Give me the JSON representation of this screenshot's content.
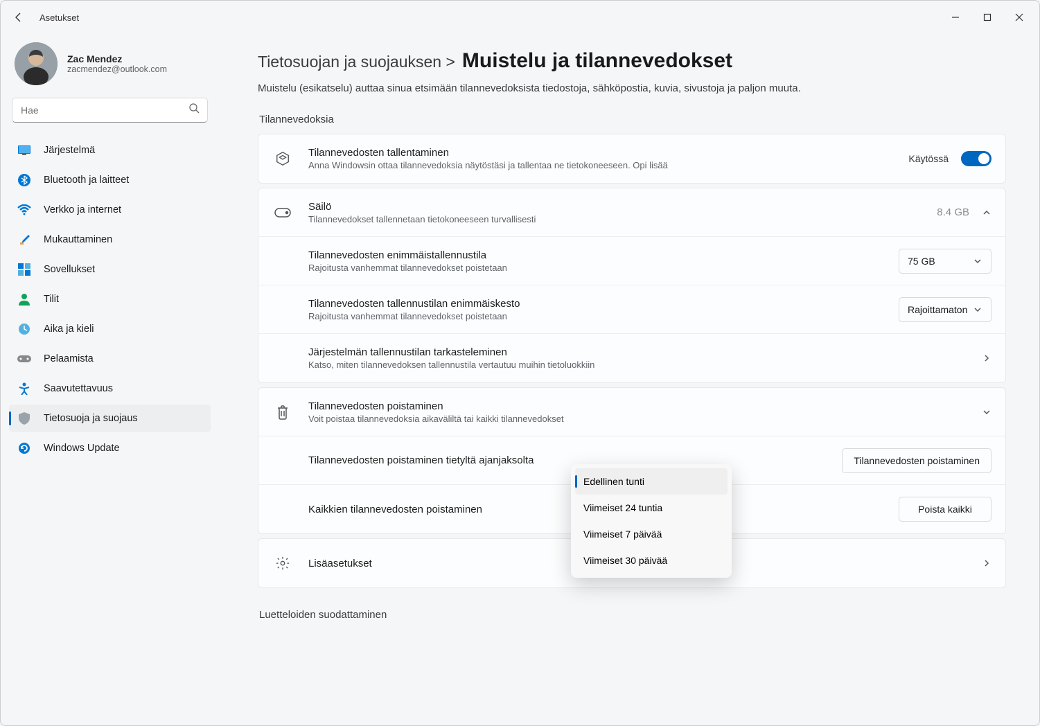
{
  "titlebar": {
    "title": "Asetukset"
  },
  "profile": {
    "name": "Zac Mendez",
    "email": "zacmendez@outlook.com"
  },
  "search": {
    "placeholder": "Hae"
  },
  "nav": {
    "items": [
      {
        "label": "Järjestelmä"
      },
      {
        "label": "Bluetooth ja laitteet"
      },
      {
        "label": "Verkko ja internet"
      },
      {
        "label": "Mukauttaminen"
      },
      {
        "label": "Sovellukset"
      },
      {
        "label": "Tilit"
      },
      {
        "label": "Aika ja kieli"
      },
      {
        "label": "Pelaamista"
      },
      {
        "label": "Saavutettavuus"
      },
      {
        "label": "Tietosuoja ja suojaus"
      },
      {
        "label": "Windows Update"
      }
    ]
  },
  "breadcrumb": {
    "parent": "Tietosuojan ja suojauksen >",
    "current": "Muistelu ja tilannevedokset"
  },
  "page_desc": "Muistelu (esikatselu) auttaa sinua etsimään tilannevedoksista tiedostoja, sähköpostia, kuvia, sivustoja ja paljon muuta.",
  "section1_label": "Tilannevedoksia",
  "rows": {
    "save": {
      "title": "Tilannevedosten tallentaminen",
      "sub": "Anna Windowsin ottaa tilannevedoksia näytöstäsi ja tallentaa ne tietokoneeseen. Opi lisää",
      "toggle_label": "Käytössä"
    },
    "storage": {
      "title": "Säilö",
      "sub": "Tilannevedokset tallennetaan tietokoneeseen turvallisesti",
      "size": "8.4 GB"
    },
    "max_storage": {
      "title": "Tilannevedosten enimmäistallennustila",
      "sub": "Rajoitusta vanhemmat tilannevedokset poistetaan",
      "value": "75 GB"
    },
    "max_duration": {
      "title": "Tilannevedosten tallennustilan enimmäiskesto",
      "sub": "Rajoitusta vanhemmat tilannevedokset poistetaan",
      "value": "Rajoittamaton"
    },
    "view_storage": {
      "title": "Järjestelmän tallennustilan tarkasteleminen",
      "sub": "Katso, miten tilannevedoksen tallennustila vertautuu muihin tietoluokkiin"
    },
    "delete": {
      "title": "Tilannevedosten poistaminen",
      "sub": "Voit poistaa tilannevedoksia aikaväliltä tai kaikki tilannevedokset"
    },
    "delete_range": {
      "title": "Tilannevedosten poistaminen tietyltä ajanjaksolta",
      "button": "Tilannevedosten poistaminen"
    },
    "delete_all": {
      "title": "Kaikkien tilannevedosten poistaminen",
      "button": "Poista kaikki"
    },
    "advanced": {
      "title": "Lisäasetukset"
    }
  },
  "dropdown": {
    "items": [
      "Edellinen tunti",
      "Viimeiset 24 tuntia",
      "Viimeiset 7 päivää",
      "Viimeiset 30 päivää"
    ]
  },
  "section2_label": "Luetteloiden suodattaminen"
}
